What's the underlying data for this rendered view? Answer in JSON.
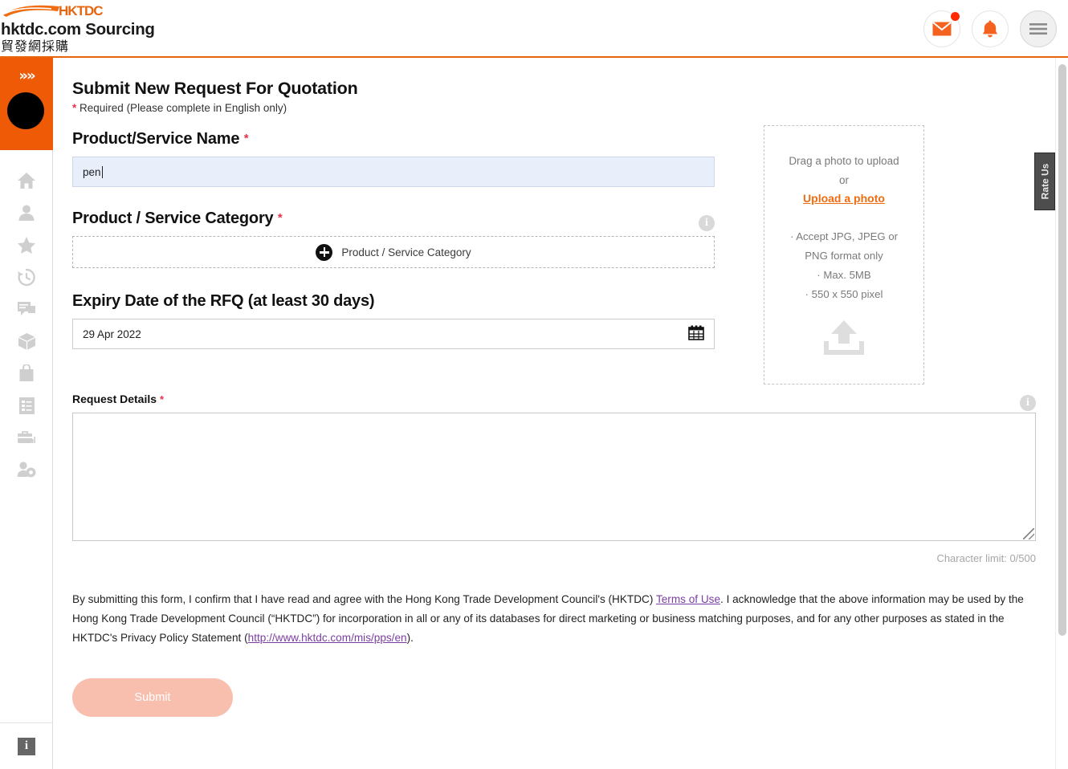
{
  "header": {
    "logo_text": "HKTDC",
    "brand_title": "hktdc.com Sourcing",
    "brand_subtitle": "貿發網採購",
    "mail_icon": "envelope-icon",
    "bell_icon": "bell-icon",
    "menu_icon": "hamburger-menu-icon",
    "accent_color": "#e8650f"
  },
  "sidebar": {
    "collapse_icon": "double-chevron-right-icon",
    "avatar": "user-avatar",
    "items": [
      {
        "icon": "home-icon",
        "name": "home"
      },
      {
        "icon": "person-icon",
        "name": "profile"
      },
      {
        "icon": "star-icon",
        "name": "favourites"
      },
      {
        "icon": "history-clock-icon",
        "name": "history"
      },
      {
        "icon": "chat-bubble-icon",
        "name": "messages"
      },
      {
        "icon": "box-package-icon",
        "name": "products"
      },
      {
        "icon": "shopping-bag-icon",
        "name": "orders"
      },
      {
        "icon": "checklist-icon",
        "name": "rfq-list"
      },
      {
        "icon": "briefcase-chart-icon",
        "name": "business"
      },
      {
        "icon": "people-gear-icon",
        "name": "account-settings"
      }
    ],
    "footer_icon": "info-icon"
  },
  "main": {
    "page_title": "Submit New Request For Quotation",
    "required_note": "Required (Please complete in English only)",
    "asterisk": "*",
    "product_name": {
      "label": "Product/Service Name",
      "value": "pen"
    },
    "category": {
      "label": "Product / Service Category",
      "picker_text": "Product / Service Category",
      "plus_icon": "plus-circle-icon",
      "info_icon": "info-circle-icon"
    },
    "expiry": {
      "label": "Expiry Date of the RFQ (at least 30 days)",
      "value": "29 Apr 2022",
      "calendar_icon": "calendar-icon"
    },
    "request_details": {
      "label": "Request Details",
      "value": "",
      "info_icon": "info-circle-icon",
      "character_limit": "Character limit: 0/500"
    },
    "consent": {
      "part1": "By submitting this form, I confirm that I have read and agree with the Hong Kong Trade Development Council's (HKTDC) ",
      "terms_link": "Terms of Use",
      "part2": ". I acknowledge that the above information may be used by the Hong Kong Trade Development Council (“HKTDC”) for incorporation in all or any of its databases for direct marketing or business matching purposes, and for any other purposes as stated in the HKTDC's Privacy Policy Statement (",
      "privacy_link": "http://www.hktdc.com/mis/pps/en",
      "part3": ")."
    },
    "submit_label": "Submit"
  },
  "upload": {
    "drag_text": "Drag a photo to upload",
    "or_text": "or",
    "link_text": "Upload a photo",
    "specs": [
      "· Accept JPG, JPEG or",
      "PNG format only",
      "· Max. 5MB",
      "· 550 x 550 pixel"
    ],
    "upload_icon": "upload-arrow-icon"
  },
  "rate_us": {
    "label": "Rate Us"
  },
  "scrollbar": {
    "name": "vertical-scrollbar"
  }
}
